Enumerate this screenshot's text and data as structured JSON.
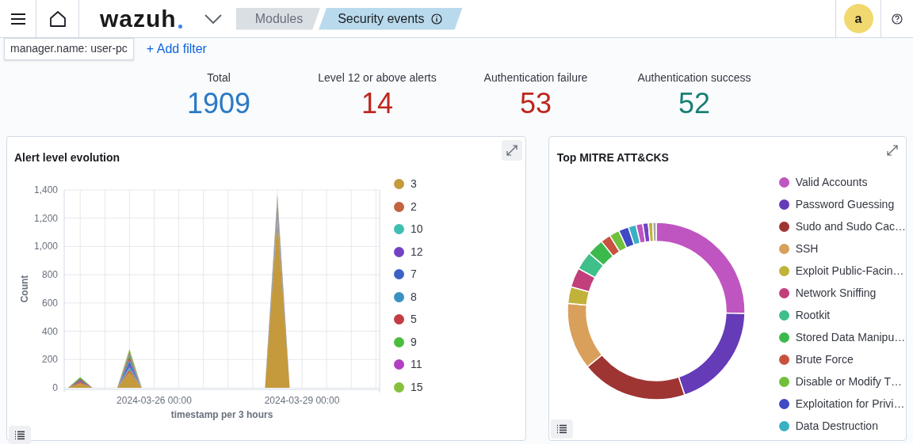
{
  "header": {
    "logo": "wazuh",
    "breadcrumbs": [
      {
        "label": "Modules",
        "selected": false
      },
      {
        "label": "Security events",
        "selected": true
      }
    ],
    "avatar": "a"
  },
  "filters": [
    {
      "label": "manager.name: user-pc"
    }
  ],
  "add_filter": "+ Add filter",
  "stats": [
    {
      "label": "Total",
      "value": "1909",
      "color": "#2a7ac6"
    },
    {
      "label": "Level 12 or above alerts",
      "value": "14",
      "color": "#bd271e"
    },
    {
      "label": "Authentication failure",
      "value": "53",
      "color": "#bd271e"
    },
    {
      "label": "Authentication success",
      "value": "52",
      "color": "#1c8075"
    }
  ],
  "alert_panel": {
    "title": "Alert level evolution",
    "chart_data": {
      "type": "area",
      "stacked": true,
      "xlabel": "timestamp per 3 hours",
      "ylabel": "Count",
      "categories": [
        null,
        null,
        null,
        null,
        null,
        null,
        null,
        "2024-03-26 00:00",
        null,
        null,
        null,
        null,
        null,
        null,
        null,
        null,
        null,
        null,
        null,
        "2024-03-29 00:00",
        null,
        null,
        null,
        null,
        null,
        null
      ],
      "ylim": [
        0,
        1400
      ],
      "yticks": [
        {
          "value": 0,
          "label": "0"
        },
        {
          "value": 200,
          "label": "200"
        },
        {
          "value": 400,
          "label": "400"
        },
        {
          "value": 600,
          "label": "600"
        },
        {
          "value": 800,
          "label": "800"
        },
        {
          "value": 1000,
          "label": "1,000"
        },
        {
          "value": 1200,
          "label": "1,200"
        },
        {
          "value": 1400,
          "label": "1,400"
        }
      ],
      "grid": true,
      "legend": "right",
      "series": [
        {
          "name": "3",
          "color": "#c49a3c",
          "values": [
            0,
            30,
            0,
            0,
            0,
            110,
            0,
            0,
            0,
            0,
            0,
            0,
            0,
            0,
            0,
            0,
            0,
            1190,
            0,
            0,
            0,
            0,
            0,
            0,
            0,
            0
          ]
        },
        {
          "name": "2",
          "color": "#c2643f",
          "values": [
            0,
            15,
            0,
            0,
            0,
            20,
            0,
            0,
            0,
            0,
            0,
            0,
            0,
            0,
            0,
            0,
            0,
            20,
            0,
            0,
            0,
            0,
            0,
            0,
            0,
            0
          ]
        },
        {
          "name": "10",
          "color": "#3fbfb1",
          "values": [
            0,
            0,
            0,
            0,
            0,
            15,
            0,
            0,
            0,
            0,
            0,
            0,
            0,
            0,
            0,
            0,
            0,
            20,
            0,
            0,
            0,
            0,
            0,
            0,
            0,
            0
          ]
        },
        {
          "name": "12",
          "color": "#7342c4",
          "values": [
            0,
            0,
            0,
            0,
            0,
            15,
            0,
            0,
            0,
            0,
            0,
            0,
            0,
            0,
            0,
            0,
            0,
            20,
            0,
            0,
            0,
            0,
            0,
            0,
            0,
            0
          ]
        },
        {
          "name": "7",
          "color": "#3c63c4",
          "values": [
            0,
            10,
            0,
            0,
            0,
            25,
            0,
            0,
            0,
            0,
            0,
            0,
            0,
            0,
            0,
            0,
            0,
            20,
            0,
            0,
            0,
            0,
            0,
            0,
            0,
            0
          ]
        },
        {
          "name": "8",
          "color": "#3a92c2",
          "values": [
            0,
            0,
            0,
            0,
            0,
            15,
            0,
            0,
            0,
            0,
            0,
            0,
            0,
            0,
            0,
            0,
            0,
            20,
            0,
            0,
            0,
            0,
            0,
            0,
            0,
            0
          ]
        },
        {
          "name": "5",
          "color": "#c23d44",
          "values": [
            0,
            10,
            0,
            0,
            0,
            20,
            0,
            0,
            0,
            0,
            0,
            0,
            0,
            0,
            0,
            0,
            0,
            20,
            0,
            0,
            0,
            0,
            0,
            0,
            0,
            0
          ]
        },
        {
          "name": "9",
          "color": "#4cbc3e",
          "values": [
            0,
            10,
            0,
            0,
            0,
            20,
            0,
            0,
            0,
            0,
            0,
            0,
            0,
            0,
            0,
            0,
            0,
            20,
            0,
            0,
            0,
            0,
            0,
            0,
            0,
            0
          ]
        },
        {
          "name": "11",
          "color": "#b13fc4",
          "values": [
            0,
            0,
            0,
            0,
            0,
            15,
            0,
            0,
            0,
            0,
            0,
            0,
            0,
            0,
            0,
            0,
            0,
            20,
            0,
            0,
            0,
            0,
            0,
            0,
            0,
            0
          ]
        },
        {
          "name": "15",
          "color": "#86c03c",
          "values": [
            0,
            0,
            0,
            0,
            0,
            20,
            0,
            0,
            0,
            0,
            0,
            0,
            0,
            0,
            0,
            0,
            0,
            20,
            0,
            0,
            0,
            0,
            0,
            0,
            0,
            0
          ]
        }
      ]
    }
  },
  "mitre_panel": {
    "title": "Top MITRE ATT&CKS",
    "legend": [
      {
        "label": "Valid Accounts",
        "color": "#bf55c0"
      },
      {
        "label": "Password Guessing",
        "color": "#653bb8"
      },
      {
        "label": "Sudo and Sudo Cac…",
        "color": "#9e3533"
      },
      {
        "label": "SSH",
        "color": "#d9a05b"
      },
      {
        "label": "Exploit Public-Facin…",
        "color": "#c1b23a"
      },
      {
        "label": "Network Sniffing",
        "color": "#c13f7a"
      },
      {
        "label": "Rootkit",
        "color": "#3fbf8a"
      },
      {
        "label": "Stored Data Manipu…",
        "color": "#3cb94c"
      },
      {
        "label": "Brute Force",
        "color": "#c8523f"
      },
      {
        "label": "Disable or Modify T…",
        "color": "#71c03b"
      },
      {
        "label": "Exploitation for Privi…",
        "color": "#3e4bc4"
      },
      {
        "label": "Data Destruction",
        "color": "#39b1c3"
      }
    ]
  }
}
